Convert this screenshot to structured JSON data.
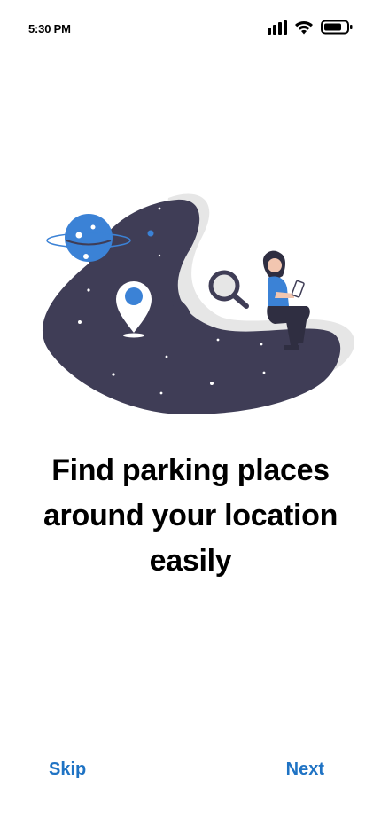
{
  "status_bar": {
    "time": "5:30 PM",
    "icons": [
      "signal-icon",
      "wifi-icon",
      "battery-icon"
    ]
  },
  "illustration": {
    "description_icons": [
      "planet-icon",
      "location-pin-icon",
      "magnifier-icon",
      "person-with-phone"
    ],
    "colors": {
      "blob": "#3f3d56",
      "shadow": "#e6e6e6",
      "accent": "#3b82d6"
    }
  },
  "onboarding": {
    "title": "Find parking places around your location easily"
  },
  "footer": {
    "skip_label": "Skip",
    "next_label": "Next",
    "accent": "#1f73c4"
  }
}
